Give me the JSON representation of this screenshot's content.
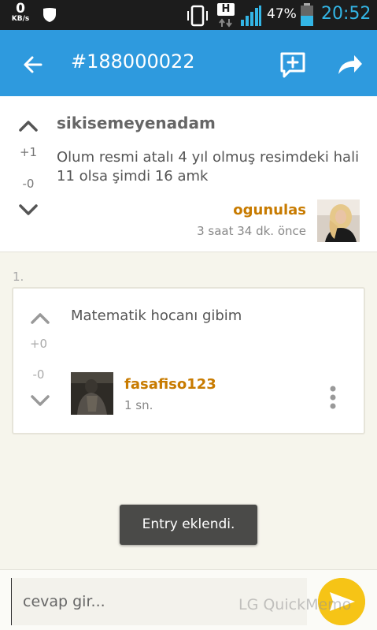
{
  "status_bar": {
    "speed_value": "0",
    "speed_unit": "KB/s",
    "network_type": "H",
    "battery_percent": "47%",
    "time": "20:52"
  },
  "app_bar": {
    "title": "#188000022",
    "color": "#2e9ade"
  },
  "entry": {
    "header": "sikisemeyenadam",
    "body": "Olum resmi atalı 4 yıl olmuş resimdeki hali 11 olsa şimdi 16 amk",
    "upvotes": "+1",
    "downvotes": "-0",
    "author": "ogunulas",
    "time": "3 saat 34 dk. önce"
  },
  "comments": [
    {
      "index": "1.",
      "text": "Matematik hocanı gibim",
      "upvotes": "+0",
      "downvotes": "-0",
      "author": "fasafiso123",
      "time": "1 sn."
    }
  ],
  "toast": {
    "message": "Entry eklendi."
  },
  "reply_bar": {
    "placeholder": "cevap gir...",
    "watermark": "LG QuickMemo"
  },
  "colors": {
    "accent": "#2e9ade",
    "username": "#c87b00",
    "send_button": "#f6c416"
  }
}
